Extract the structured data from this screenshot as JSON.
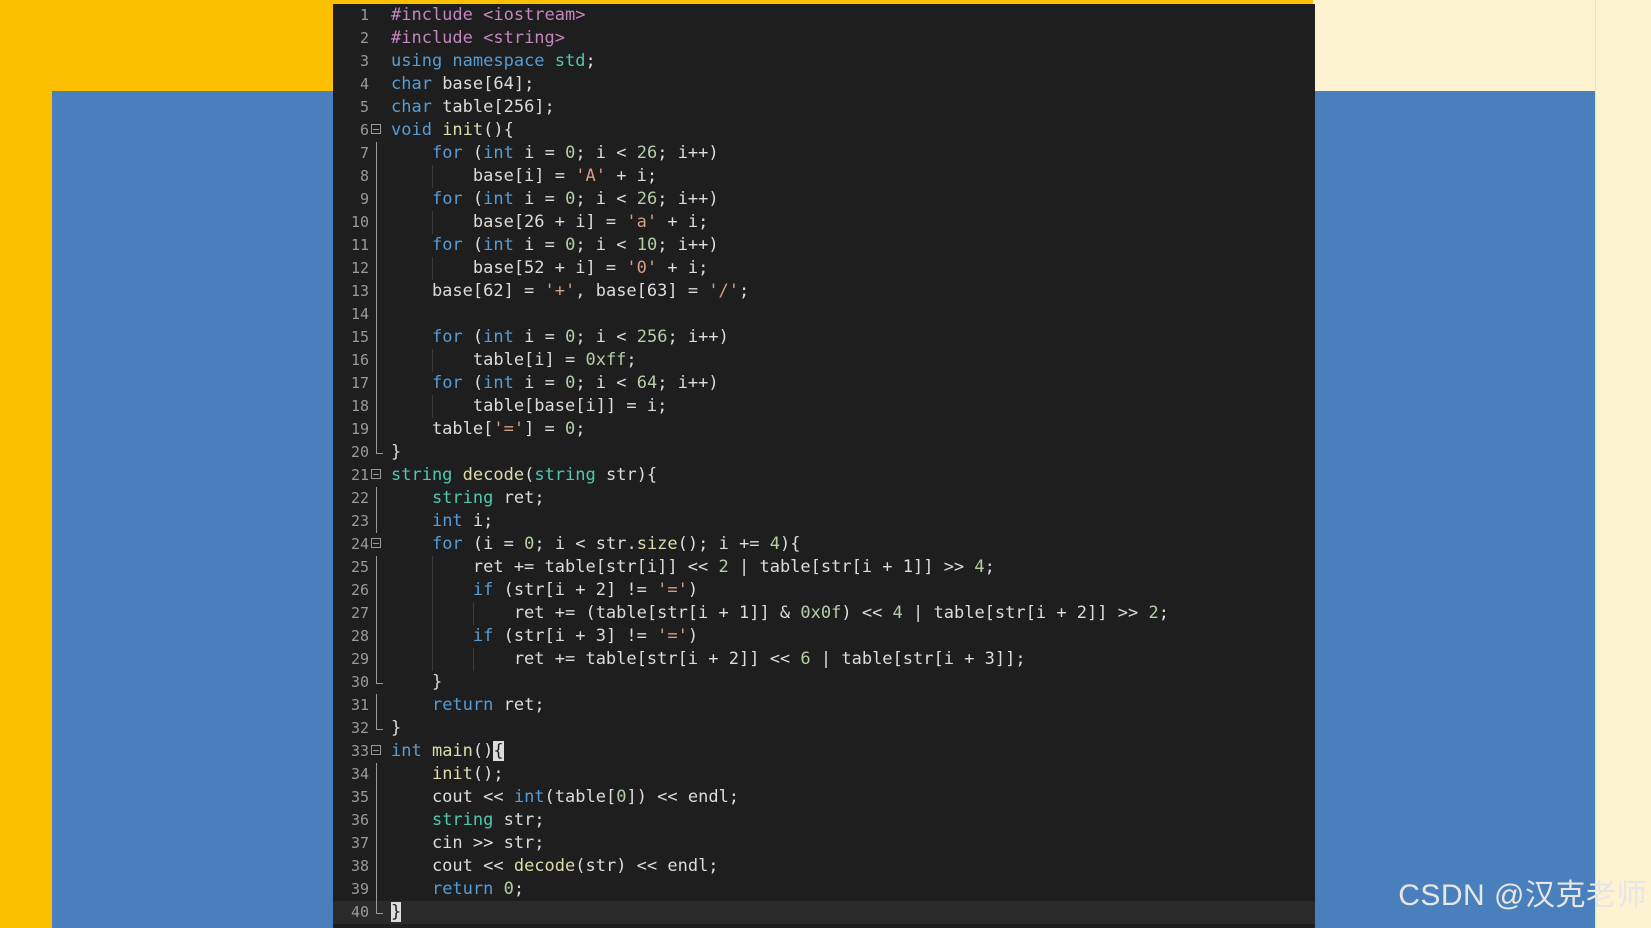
{
  "watermark": "CSDN @汉克老师",
  "colors": {
    "preprocessor": "#c586c0",
    "keyword": "#569cd6",
    "type": "#4ec9b0",
    "function": "#dcdcaa",
    "string": "#d69d85",
    "number": "#b5cea8",
    "plain": "#dcdcdc",
    "background": "#1e1e1e",
    "slide_yellow": "#fdc000",
    "slide_blue": "#4a7fbd"
  },
  "code": [
    {
      "n": "1",
      "fold": "",
      "tokens": [
        [
          "pre",
          "#include "
        ],
        [
          "pre",
          "<iostream>"
        ]
      ]
    },
    {
      "n": "2",
      "fold": "",
      "tokens": [
        [
          "pre",
          "#include "
        ],
        [
          "pre",
          "<string>"
        ]
      ]
    },
    {
      "n": "3",
      "fold": "",
      "tokens": [
        [
          "kw",
          "using "
        ],
        [
          "kw",
          "namespace "
        ],
        [
          "type",
          "std"
        ],
        [
          "plain",
          ";"
        ]
      ]
    },
    {
      "n": "4",
      "fold": "",
      "tokens": [
        [
          "kw",
          "char "
        ],
        [
          "plain",
          "base[64];"
        ]
      ]
    },
    {
      "n": "5",
      "fold": "",
      "tokens": [
        [
          "kw",
          "char "
        ],
        [
          "plain",
          "table[256];"
        ]
      ]
    },
    {
      "n": "6",
      "fold": "open",
      "tokens": [
        [
          "kw",
          "void "
        ],
        [
          "fn",
          "init"
        ],
        [
          "plain",
          "(){"
        ]
      ]
    },
    {
      "n": "7",
      "fold": "line",
      "tokens": [
        [
          "plain",
          "    "
        ],
        [
          "kw",
          "for "
        ],
        [
          "plain",
          "("
        ],
        [
          "kw",
          "int "
        ],
        [
          "plain",
          "i = "
        ],
        [
          "num",
          "0"
        ],
        [
          "plain",
          "; i < "
        ],
        [
          "num",
          "26"
        ],
        [
          "plain",
          "; i++)"
        ]
      ]
    },
    {
      "n": "8",
      "fold": "line",
      "tokens": [
        [
          "plain",
          "        base[i] = "
        ],
        [
          "str",
          "'A'"
        ],
        [
          "plain",
          " + i;"
        ]
      ]
    },
    {
      "n": "9",
      "fold": "line",
      "tokens": [
        [
          "plain",
          "    "
        ],
        [
          "kw",
          "for "
        ],
        [
          "plain",
          "("
        ],
        [
          "kw",
          "int "
        ],
        [
          "plain",
          "i = "
        ],
        [
          "num",
          "0"
        ],
        [
          "plain",
          "; i < "
        ],
        [
          "num",
          "26"
        ],
        [
          "plain",
          "; i++)"
        ]
      ]
    },
    {
      "n": "10",
      "fold": "line",
      "tokens": [
        [
          "plain",
          "        base[26 + i] = "
        ],
        [
          "str",
          "'a'"
        ],
        [
          "plain",
          " + i;"
        ]
      ]
    },
    {
      "n": "11",
      "fold": "line",
      "tokens": [
        [
          "plain",
          "    "
        ],
        [
          "kw",
          "for "
        ],
        [
          "plain",
          "("
        ],
        [
          "kw",
          "int "
        ],
        [
          "plain",
          "i = "
        ],
        [
          "num",
          "0"
        ],
        [
          "plain",
          "; i < "
        ],
        [
          "num",
          "10"
        ],
        [
          "plain",
          "; i++)"
        ]
      ]
    },
    {
      "n": "12",
      "fold": "line",
      "tokens": [
        [
          "plain",
          "        base[52 + i] = "
        ],
        [
          "str",
          "'0'"
        ],
        [
          "plain",
          " + i;"
        ]
      ]
    },
    {
      "n": "13",
      "fold": "line",
      "tokens": [
        [
          "plain",
          "    base[62] = "
        ],
        [
          "str",
          "'+'"
        ],
        [
          "plain",
          ", base[63] = "
        ],
        [
          "str",
          "'/'"
        ],
        [
          "plain",
          ";"
        ]
      ]
    },
    {
      "n": "14",
      "fold": "line",
      "tokens": []
    },
    {
      "n": "15",
      "fold": "line",
      "tokens": [
        [
          "plain",
          "    "
        ],
        [
          "kw",
          "for "
        ],
        [
          "plain",
          "("
        ],
        [
          "kw",
          "int "
        ],
        [
          "plain",
          "i = "
        ],
        [
          "num",
          "0"
        ],
        [
          "plain",
          "; i < "
        ],
        [
          "num",
          "256"
        ],
        [
          "plain",
          "; i++)"
        ]
      ]
    },
    {
      "n": "16",
      "fold": "line",
      "tokens": [
        [
          "plain",
          "        table[i] = "
        ],
        [
          "num",
          "0xff"
        ],
        [
          "plain",
          ";"
        ]
      ]
    },
    {
      "n": "17",
      "fold": "line",
      "tokens": [
        [
          "plain",
          "    "
        ],
        [
          "kw",
          "for "
        ],
        [
          "plain",
          "("
        ],
        [
          "kw",
          "int "
        ],
        [
          "plain",
          "i = "
        ],
        [
          "num",
          "0"
        ],
        [
          "plain",
          "; i < "
        ],
        [
          "num",
          "64"
        ],
        [
          "plain",
          "; i++)"
        ]
      ]
    },
    {
      "n": "18",
      "fold": "line",
      "tokens": [
        [
          "plain",
          "        table[base[i]] = i;"
        ]
      ]
    },
    {
      "n": "19",
      "fold": "line",
      "tokens": [
        [
          "plain",
          "    table["
        ],
        [
          "str",
          "'='"
        ],
        [
          "plain",
          "] = "
        ],
        [
          "num",
          "0"
        ],
        [
          "plain",
          ";"
        ]
      ]
    },
    {
      "n": "20",
      "fold": "end",
      "tokens": [
        [
          "plain",
          "}"
        ]
      ]
    },
    {
      "n": "21",
      "fold": "open",
      "tokens": [
        [
          "type",
          "string "
        ],
        [
          "fn",
          "decode"
        ],
        [
          "plain",
          "("
        ],
        [
          "type",
          "string "
        ],
        [
          "plain",
          "str){"
        ]
      ]
    },
    {
      "n": "22",
      "fold": "line",
      "tokens": [
        [
          "plain",
          "    "
        ],
        [
          "type",
          "string "
        ],
        [
          "plain",
          "ret;"
        ]
      ]
    },
    {
      "n": "23",
      "fold": "line",
      "tokens": [
        [
          "plain",
          "    "
        ],
        [
          "kw",
          "int "
        ],
        [
          "plain",
          "i;"
        ]
      ]
    },
    {
      "n": "24",
      "fold": "open",
      "tokens": [
        [
          "plain",
          "    "
        ],
        [
          "kw",
          "for "
        ],
        [
          "plain",
          "(i = "
        ],
        [
          "num",
          "0"
        ],
        [
          "plain",
          "; i < str."
        ],
        [
          "fn",
          "size"
        ],
        [
          "plain",
          "(); i += "
        ],
        [
          "num",
          "4"
        ],
        [
          "plain",
          "){"
        ]
      ]
    },
    {
      "n": "25",
      "fold": "line",
      "tokens": [
        [
          "plain",
          "        ret += table[str[i]] << "
        ],
        [
          "num",
          "2"
        ],
        [
          "plain",
          " | table[str[i + 1]] >> "
        ],
        [
          "num",
          "4"
        ],
        [
          "plain",
          ";"
        ]
      ]
    },
    {
      "n": "26",
      "fold": "line",
      "tokens": [
        [
          "plain",
          "        "
        ],
        [
          "kw",
          "if "
        ],
        [
          "plain",
          "(str[i + 2] != "
        ],
        [
          "str",
          "'='"
        ],
        [
          "plain",
          ")"
        ]
      ]
    },
    {
      "n": "27",
      "fold": "line",
      "tokens": [
        [
          "plain",
          "            ret += (table[str[i + 1]] & "
        ],
        [
          "num",
          "0x0f"
        ],
        [
          "plain",
          ") << "
        ],
        [
          "num",
          "4"
        ],
        [
          "plain",
          " | table[str[i + 2]] >> "
        ],
        [
          "num",
          "2"
        ],
        [
          "plain",
          ";"
        ]
      ]
    },
    {
      "n": "28",
      "fold": "line",
      "tokens": [
        [
          "plain",
          "        "
        ],
        [
          "kw",
          "if "
        ],
        [
          "plain",
          "(str[i + 3] != "
        ],
        [
          "str",
          "'='"
        ],
        [
          "plain",
          ")"
        ]
      ]
    },
    {
      "n": "29",
      "fold": "line",
      "tokens": [
        [
          "plain",
          "            ret += table[str[i + 2]] << "
        ],
        [
          "num",
          "6"
        ],
        [
          "plain",
          " | table[str[i + 3]];"
        ]
      ]
    },
    {
      "n": "30",
      "fold": "end",
      "tokens": [
        [
          "plain",
          "    }"
        ]
      ]
    },
    {
      "n": "31",
      "fold": "line",
      "tokens": [
        [
          "plain",
          "    "
        ],
        [
          "kw",
          "return "
        ],
        [
          "plain",
          "ret;"
        ]
      ]
    },
    {
      "n": "32",
      "fold": "end",
      "tokens": [
        [
          "plain",
          "}"
        ]
      ]
    },
    {
      "n": "33",
      "fold": "open",
      "tokens": [
        [
          "kw",
          "int "
        ],
        [
          "fn",
          "main"
        ],
        [
          "plain",
          "()"
        ],
        [
          "caret",
          "{"
        ]
      ]
    },
    {
      "n": "34",
      "fold": "line",
      "tokens": [
        [
          "plain",
          "    "
        ],
        [
          "fn",
          "init"
        ],
        [
          "plain",
          "();"
        ]
      ]
    },
    {
      "n": "35",
      "fold": "line",
      "tokens": [
        [
          "plain",
          "    cout << "
        ],
        [
          "kw",
          "int"
        ],
        [
          "plain",
          "(table["
        ],
        [
          "num",
          "0"
        ],
        [
          "plain",
          "]) << endl;"
        ]
      ]
    },
    {
      "n": "36",
      "fold": "line",
      "tokens": [
        [
          "plain",
          "    "
        ],
        [
          "type",
          "string "
        ],
        [
          "plain",
          "str;"
        ]
      ]
    },
    {
      "n": "37",
      "fold": "line",
      "tokens": [
        [
          "plain",
          "    cin >> str;"
        ]
      ]
    },
    {
      "n": "38",
      "fold": "line",
      "tokens": [
        [
          "plain",
          "    cout << "
        ],
        [
          "fn",
          "decode"
        ],
        [
          "plain",
          "(str) << endl;"
        ]
      ]
    },
    {
      "n": "39",
      "fold": "line",
      "tokens": [
        [
          "plain",
          "    "
        ],
        [
          "kw",
          "return "
        ],
        [
          "num",
          "0"
        ],
        [
          "plain",
          ";"
        ]
      ]
    },
    {
      "n": "40",
      "fold": "end",
      "current": true,
      "tokens": [
        [
          "caret",
          "}"
        ]
      ]
    }
  ]
}
